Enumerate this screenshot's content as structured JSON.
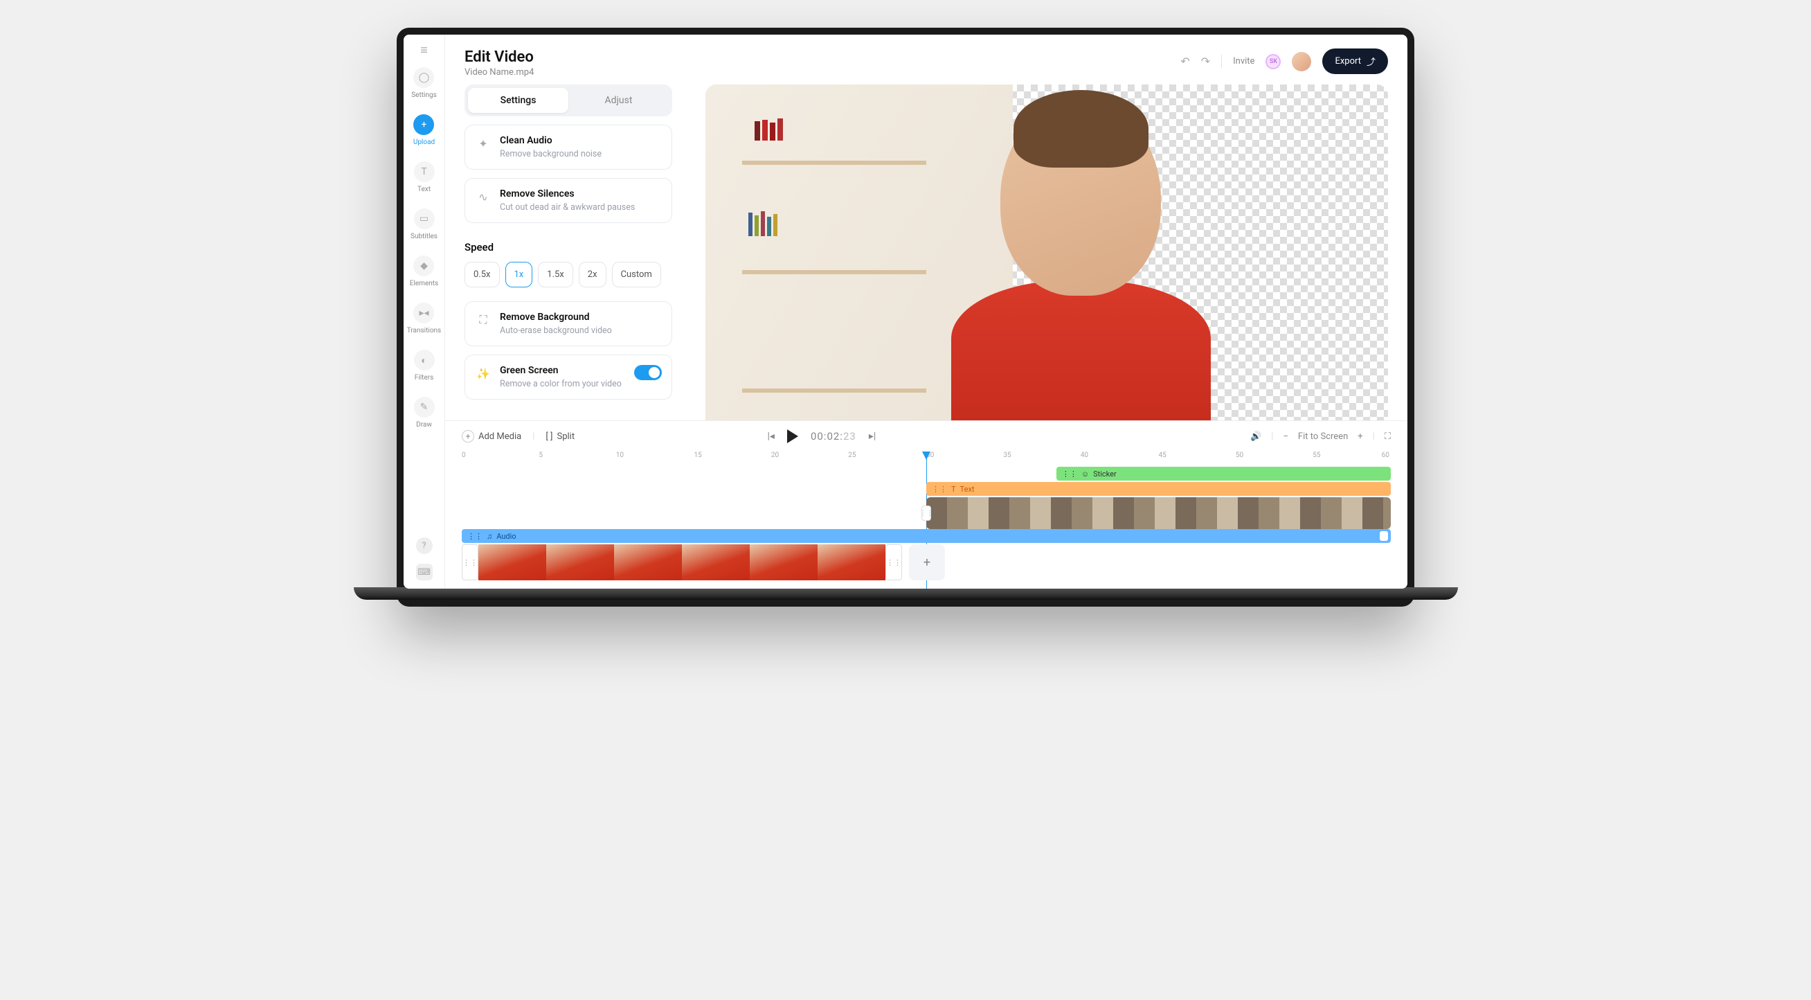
{
  "header": {
    "title": "Edit Video",
    "subtitle": "Video Name.mp4",
    "invite": "Invite",
    "avatar_initials": "SK",
    "export": "Export"
  },
  "sidebar": {
    "items": [
      {
        "label": "Settings"
      },
      {
        "label": "Upload"
      },
      {
        "label": "Text"
      },
      {
        "label": "Subtitles"
      },
      {
        "label": "Elements"
      },
      {
        "label": "Transitions"
      },
      {
        "label": "Filters"
      },
      {
        "label": "Draw"
      }
    ]
  },
  "tabs": {
    "settings": "Settings",
    "adjust": "Adjust"
  },
  "panel": {
    "clean_audio": {
      "title": "Clean Audio",
      "desc": "Remove background noise"
    },
    "remove_silences": {
      "title": "Remove Silences",
      "desc": "Cut out dead air & awkward pauses"
    },
    "speed_label": "Speed",
    "speed_options": [
      "0.5x",
      "1x",
      "1.5x",
      "2x",
      "Custom"
    ],
    "speed_selected": "1x",
    "remove_bg": {
      "title": "Remove Background",
      "desc": "Auto-erase background video"
    },
    "green_screen": {
      "title": "Green Screen",
      "desc": "Remove a color from your video",
      "enabled": true
    }
  },
  "timeline": {
    "add_media": "Add Media",
    "split": "Split",
    "time_main": "00:02:",
    "time_ms": "23",
    "fit": "Fit to Screen",
    "ruler": [
      "0",
      "5",
      "10",
      "15",
      "20",
      "25",
      "30",
      "35",
      "40",
      "45",
      "50",
      "55",
      "60"
    ],
    "playhead_pos": "50%",
    "tracks": {
      "sticker": "Sticker",
      "text": "Text",
      "audio": "Audio"
    }
  }
}
